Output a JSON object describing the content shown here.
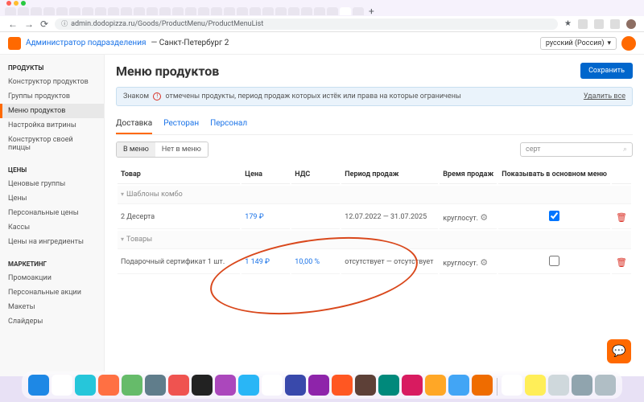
{
  "browser": {
    "url": "admin.dodopizza.ru/Goods/ProductMenu/ProductMenuList"
  },
  "header": {
    "admin_role": "Администратор подразделения",
    "location": "— Санкт-Петербург 2",
    "language": "русский (Россия)"
  },
  "sidebar": {
    "sections": [
      {
        "title": "ПРОДУКТЫ",
        "items": [
          "Конструктор продуктов",
          "Группы продуктов",
          "Меню продуктов",
          "Настройка витрины",
          "Конструктор своей пиццы"
        ]
      },
      {
        "title": "ЦЕНЫ",
        "items": [
          "Ценовые группы",
          "Цены",
          "Персональные цены",
          "Кассы",
          "Цены на ингредиенты"
        ]
      },
      {
        "title": "МАРКЕТИНГ",
        "items": [
          "Промоакции",
          "Персональные акции",
          "Макеты",
          "Слайдеры"
        ]
      }
    ],
    "active": "Меню продуктов"
  },
  "page": {
    "title": "Меню продуктов",
    "save_btn": "Сохранить",
    "banner_prefix": "Знаком",
    "banner_text": "отмечены продукты, период продаж которых истёк или права на которые ограничены",
    "delete_all": "Удалить все",
    "tabs": [
      "Доставка",
      "Ресторан",
      "Персонал"
    ],
    "active_tab": "Доставка",
    "filters": {
      "in_menu": "В меню",
      "not_in_menu": "Нет в меню"
    },
    "search_value": "серт",
    "columns": {
      "product": "Товар",
      "price": "Цена",
      "vat": "НДС",
      "sale_period": "Период продаж",
      "sale_time": "Время продаж",
      "show": "Показывать в основном меню"
    },
    "group_combo": "Шаблоны комбо",
    "group_goods": "Товары",
    "rows": [
      {
        "name": "2 Десерта",
        "price": "179 ₽",
        "vat": "",
        "period": "12.07.2022 — 31.07.2025",
        "time": "круглосут.",
        "show": true
      },
      {
        "name": "Подарочный сертификат 1 шт.",
        "price": "1 149 ₽",
        "vat": "10,00 %",
        "period": "отсутствует — отсутствует",
        "time": "круглосут.",
        "show": false
      }
    ]
  },
  "dock_colors": [
    "#1e88e5",
    "#ffffff",
    "#26c6da",
    "#ff7043",
    "#66bb6a",
    "#607d8b",
    "#ef5350",
    "#222222",
    "#ab47bc",
    "#29b6f6",
    "#ffffff",
    "#3949ab",
    "#8e24aa",
    "#ff5722",
    "#5d4037",
    "#00897b",
    "#d81b60",
    "#ffa726",
    "#42a5f5",
    "#ef6c00",
    "#ffffff",
    "#ffee58",
    "#cfd8dc",
    "#90a4ae",
    "#b0bec5"
  ]
}
